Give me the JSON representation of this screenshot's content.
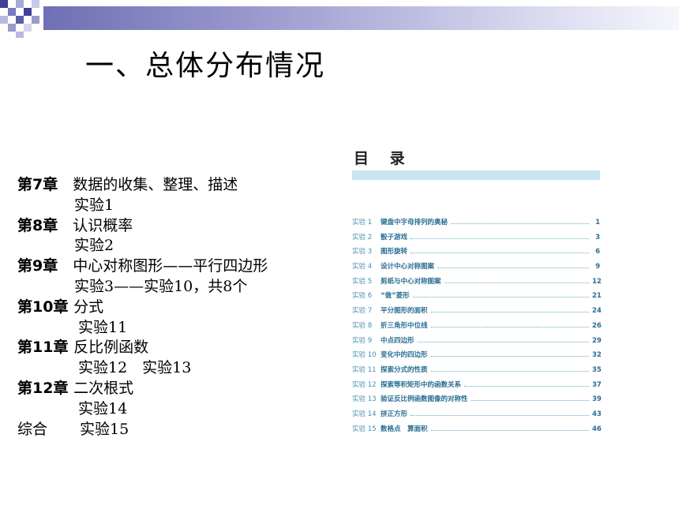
{
  "slide_title": "一、总体分布情况",
  "chapters": [
    {
      "chapter": "第7章",
      "title": "数据的收集、整理、描述",
      "experiments": "实验1"
    },
    {
      "chapter": "第8章",
      "title": "认识概率",
      "experiments": "实验2"
    },
    {
      "chapter": "第9章",
      "title": "中心对称图形——平行四边形",
      "experiments": "实验3——实验10，共8个"
    },
    {
      "chapter": "第10章",
      "title": "分式",
      "experiments": "实验11"
    },
    {
      "chapter": "第11章",
      "title": "反比例函数",
      "experiments": "实验12　实验13"
    },
    {
      "chapter": "第12章",
      "title": "二次根式",
      "experiments": "实验14"
    }
  ],
  "summary": {
    "label": "综合",
    "experiments": "实验15"
  },
  "contents": {
    "heading": "目 录",
    "entries": [
      {
        "num": "实验 1",
        "name": "键盘中字母排列的奥秘",
        "page": "1"
      },
      {
        "num": "实验 2",
        "name": "骰子游戏",
        "page": "3"
      },
      {
        "num": "实验 3",
        "name": "图形旋转",
        "page": "6"
      },
      {
        "num": "实验 4",
        "name": "设计中心对称图案",
        "page": "9"
      },
      {
        "num": "实验 5",
        "name": "剪纸与中心对称图案",
        "page": "12"
      },
      {
        "num": "实验 6",
        "name": "“做”菱形",
        "page": "21"
      },
      {
        "num": "实验 7",
        "name": "平分图形的面积",
        "page": "24"
      },
      {
        "num": "实验 8",
        "name": "折三角形中位线",
        "page": "26"
      },
      {
        "num": "实验 9",
        "name": "中点四边形",
        "page": "29"
      },
      {
        "num": "实验 10",
        "name": "变化中的四边形",
        "page": "32"
      },
      {
        "num": "实验 11",
        "name": "探索分式的性质",
        "page": "35"
      },
      {
        "num": "实验 12",
        "name": "探索等积矩形中的函数关系",
        "page": "37"
      },
      {
        "num": "实验 13",
        "name": "验证反比例函数图像的对称性",
        "page": "39"
      },
      {
        "num": "实验 14",
        "name": "拼正方形",
        "page": "43"
      },
      {
        "num": "实验 15",
        "name": "数格点　算面积",
        "page": "46"
      }
    ]
  },
  "colors": {
    "banner": "#6f6fb4",
    "toc_bar": "#c8e6f2",
    "toc_text": "#2a6e93"
  }
}
